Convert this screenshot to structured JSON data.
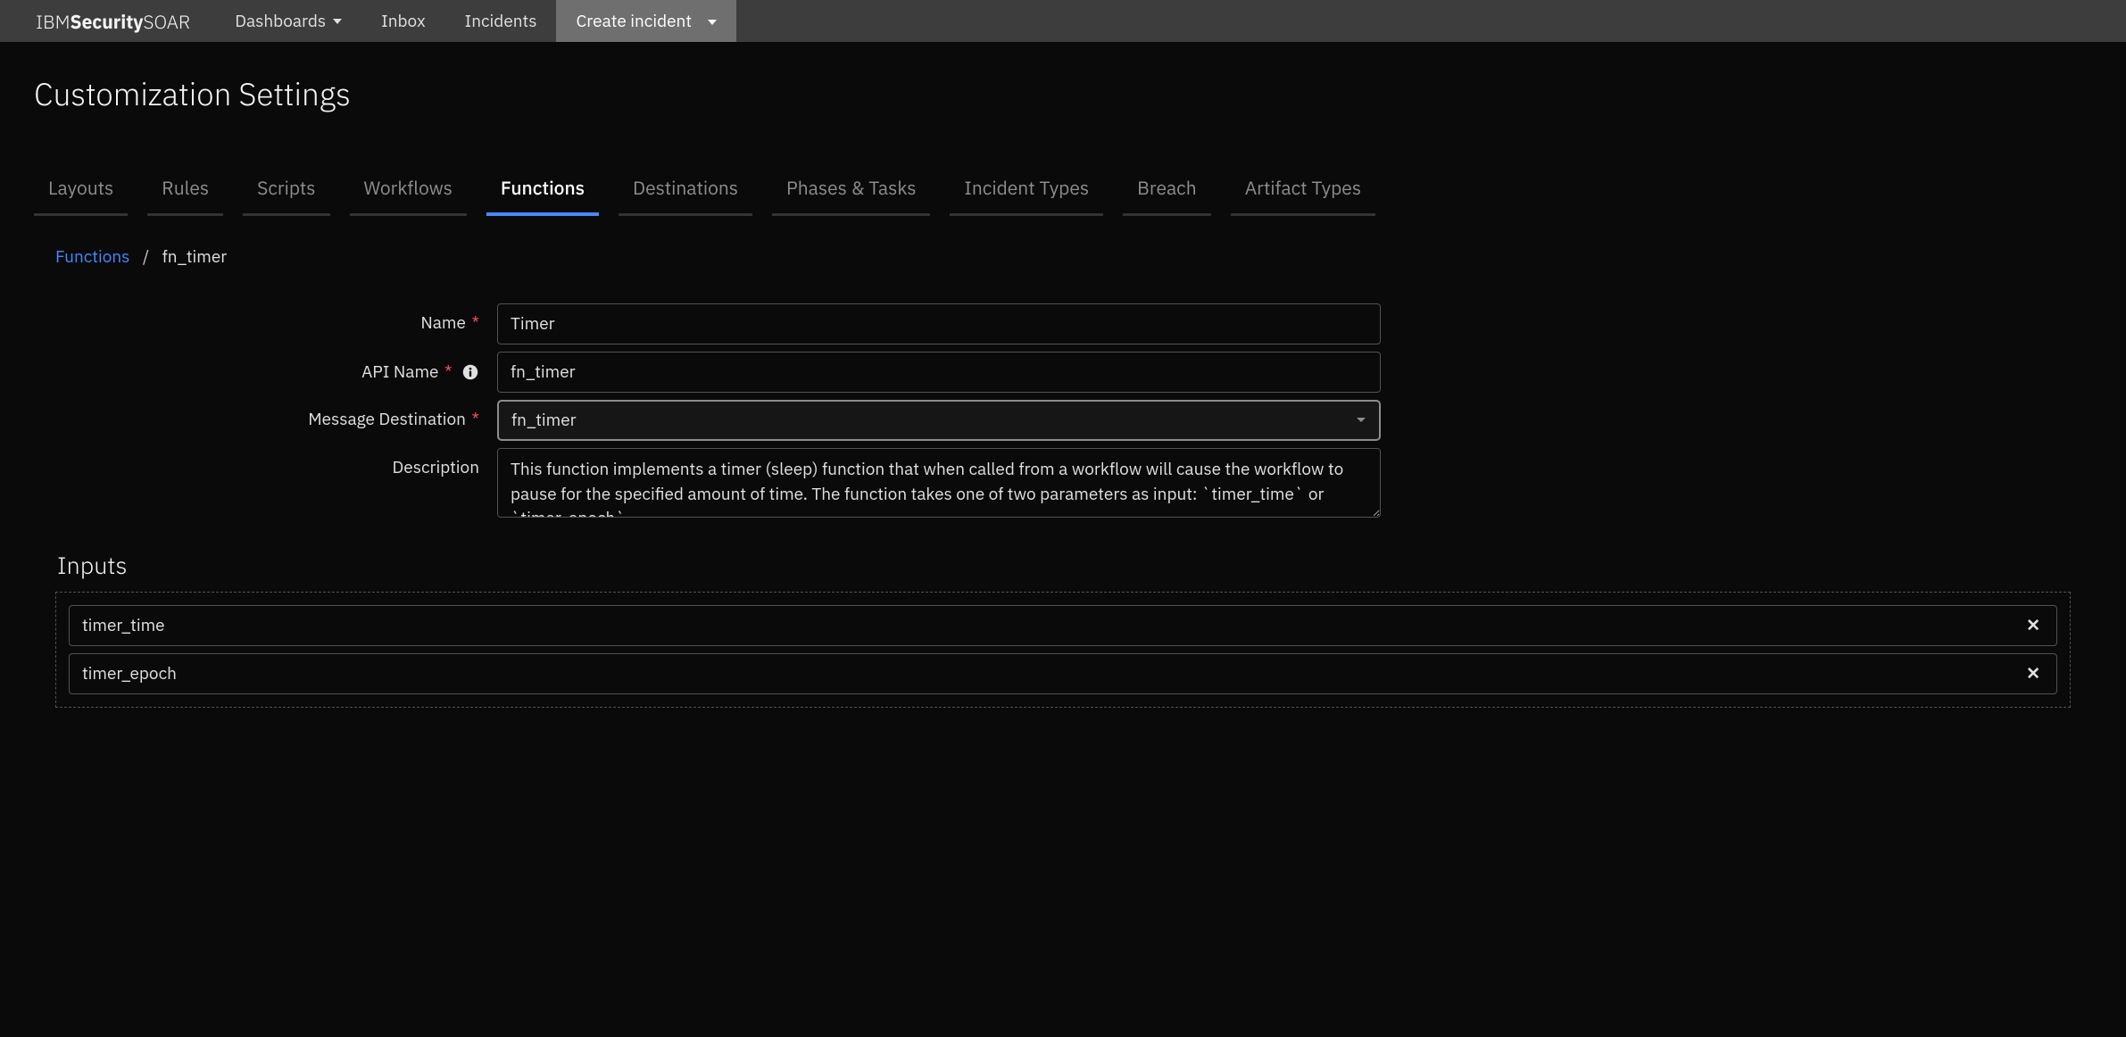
{
  "logo": {
    "brand1": "IBM ",
    "brand2": "Security",
    "brand3": " SOAR"
  },
  "nav": {
    "dashboards": "Dashboards",
    "inbox": "Inbox",
    "incidents": "Incidents",
    "create_incident": "Create incident"
  },
  "page": {
    "title": "Customization Settings"
  },
  "tabs": {
    "layouts": "Layouts",
    "rules": "Rules",
    "scripts": "Scripts",
    "workflows": "Workflows",
    "functions": "Functions",
    "destinations": "Destinations",
    "phases_tasks": "Phases & Tasks",
    "incident_types": "Incident Types",
    "breach": "Breach",
    "artifact_types": "Artifact Types"
  },
  "breadcrumb": {
    "parent": "Functions",
    "current": "fn_timer"
  },
  "form": {
    "name_label": "Name",
    "name_value": "Timer",
    "api_name_label": "API Name",
    "api_name_value": "fn_timer",
    "message_dest_label": "Message Destination",
    "message_dest_value": "fn_timer",
    "description_label": "Description",
    "description_value": "This function implements a timer (sleep) function that when called from a workflow will cause the workflow to pause for the specified amount of time. The function takes one of two parameters as input: `timer_time` or `timer_epoch`."
  },
  "inputs_section": {
    "title": "Inputs",
    "items": [
      {
        "name": "timer_time"
      },
      {
        "name": "timer_epoch"
      }
    ]
  }
}
